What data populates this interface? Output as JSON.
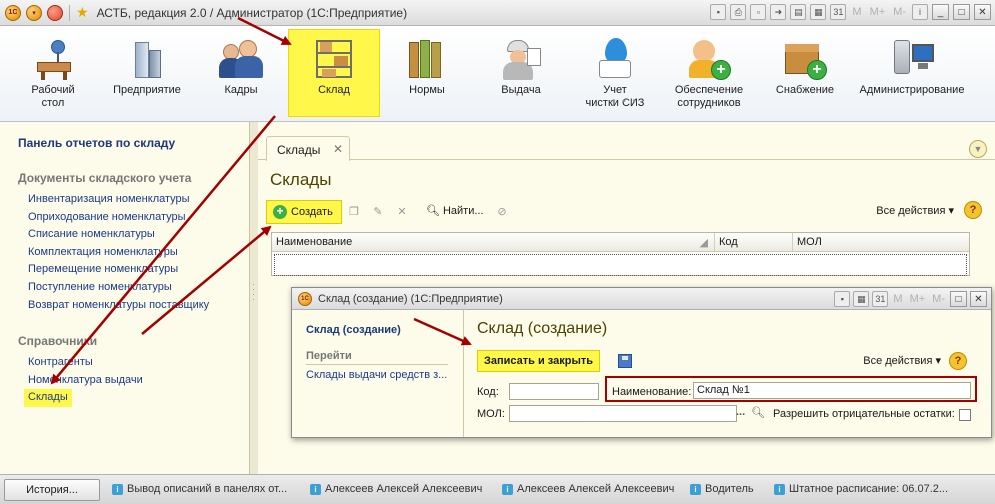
{
  "window": {
    "title": "АСТБ, редакция 2.0 / Администратор  (1С:Предприятие)",
    "logo_text": "1С",
    "menu_m_labels": [
      "M",
      "M+",
      "M-"
    ]
  },
  "sections": [
    {
      "label": "Рабочий\nстол",
      "icon": "desk-icon"
    },
    {
      "label": "Предприятие",
      "icon": "building-icon"
    },
    {
      "label": "Кадры",
      "icon": "people-icon"
    },
    {
      "label": "Склад",
      "icon": "warehouse-shelf-icon",
      "active": true
    },
    {
      "label": "Нормы",
      "icon": "books-icon"
    },
    {
      "label": "Выдача",
      "icon": "worker-icon"
    },
    {
      "label": "Учет\nчистки СИЗ",
      "icon": "drop-shirt-icon"
    },
    {
      "label": "Обеспечение\nсотрудников",
      "icon": "worker-plus-icon"
    },
    {
      "label": "Снабжение",
      "icon": "box-plus-icon"
    },
    {
      "label": "Администрирование",
      "icon": "server-monitor-icon"
    }
  ],
  "sections_more": "• • •",
  "left_panel": {
    "title": "Панель отчетов по складу",
    "groups": [
      {
        "title": "Документы складского учета",
        "links": [
          "Инвентаризация номенклатуры",
          "Оприходование номенклатуры",
          "Списание номенклатуры",
          "Комплектация номенклатуры",
          "Перемещение номенклатуры",
          "Поступление номенклатуры",
          "Возврат номенклатуры поставщику"
        ]
      },
      {
        "title": "Справочники",
        "links": [
          "Контрагенты",
          "Номенклатура выдачи",
          "Склады"
        ]
      }
    ]
  },
  "workspace": {
    "tab_label": "Склады",
    "title": "Склады",
    "toolbar": {
      "create": "Создать",
      "find": "Найти...",
      "all_actions": "Все действия ▾",
      "help": "?"
    },
    "columns": [
      "Наименование",
      "Код",
      "МОЛ"
    ]
  },
  "modal": {
    "title": "Склад (создание)  (1С:Предприятие)",
    "left_title": "Склад (создание)",
    "left_group": "Перейти",
    "left_link": "Склады выдачи средств з...",
    "heading": "Склад (создание)",
    "save_close": "Записать и закрыть",
    "all_actions": "Все действия ▾",
    "help": "?",
    "fields": {
      "code_label": "Код:",
      "code_value": "",
      "name_label": "Наименование:",
      "name_value": "Склад №1",
      "mol_label": "МОЛ:",
      "mol_value": "",
      "negative_label": "Разрешить отрицательные остатки:",
      "negative_checked": false
    }
  },
  "statusbar": {
    "history": "История...",
    "items": [
      "Вывод описаний в панелях от...",
      "Алексеев Алексей Алексеевич",
      "Алексеев Алексей Алексеевич",
      "Водитель",
      "Штатное расписание: 06.07.2..."
    ]
  },
  "colors": {
    "highlight": "#fff84a",
    "arrow": "#a40000",
    "link": "#1b3a8f"
  }
}
